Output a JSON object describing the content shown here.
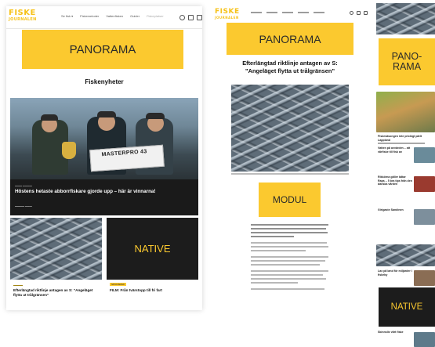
{
  "panel1": {
    "logo": {
      "line1": "FISKE",
      "line2": "JOURNALEN"
    },
    "nav": [
      "Se fisk ▾",
      "Fiskemetoder",
      "Vattenfisken",
      "Guider",
      "Fiskeplatser"
    ],
    "panorama_label": "PANORAMA",
    "section_title": "Fiskenyheter",
    "hero": {
      "banner_text": "MASTERPRO 43",
      "title": "Höstens hetaste abborrfiskare gjorde upp – här är vinnarna!"
    },
    "card1": {
      "title": "Efterlängtad riktlinje antagen av S: ”Angeläget flytta ut trålgränsen”"
    },
    "card2": {
      "native_label": "NATIVE",
      "tag": "SPONSRAD",
      "title": "FILM: Från tvärstopp till fri fart"
    }
  },
  "panel2": {
    "logo": {
      "line1": "FISKE",
      "line2": "JOURNALEN"
    },
    "panorama_label": "PANORAMA",
    "title": "Efterlängtad riktlinje antagen av S: ”Angeläget flytta ut trålgränsen”",
    "modul_label": "MODUL"
  },
  "panel3": {
    "panorama_label": "PANO- RAMA",
    "native_label": "NATIVE",
    "headlines": [
      "Fiskesäsongen inte prickigt pärlt Lappland",
      "Vatten på avvärden – att vårfiske till fisk av",
      "Rikkörna gäller båtar Raps – 5 bra tips från den danska vården",
      "Girigaste Sandinen",
      "Lax på land för miljarder i fiskeby",
      "Skinnsliv vårt fiske"
    ]
  },
  "colors": {
    "ad_yellow": "#fbc92f",
    "native_bg": "#1c1c1c",
    "logo_yellow": "#f6c21a"
  }
}
